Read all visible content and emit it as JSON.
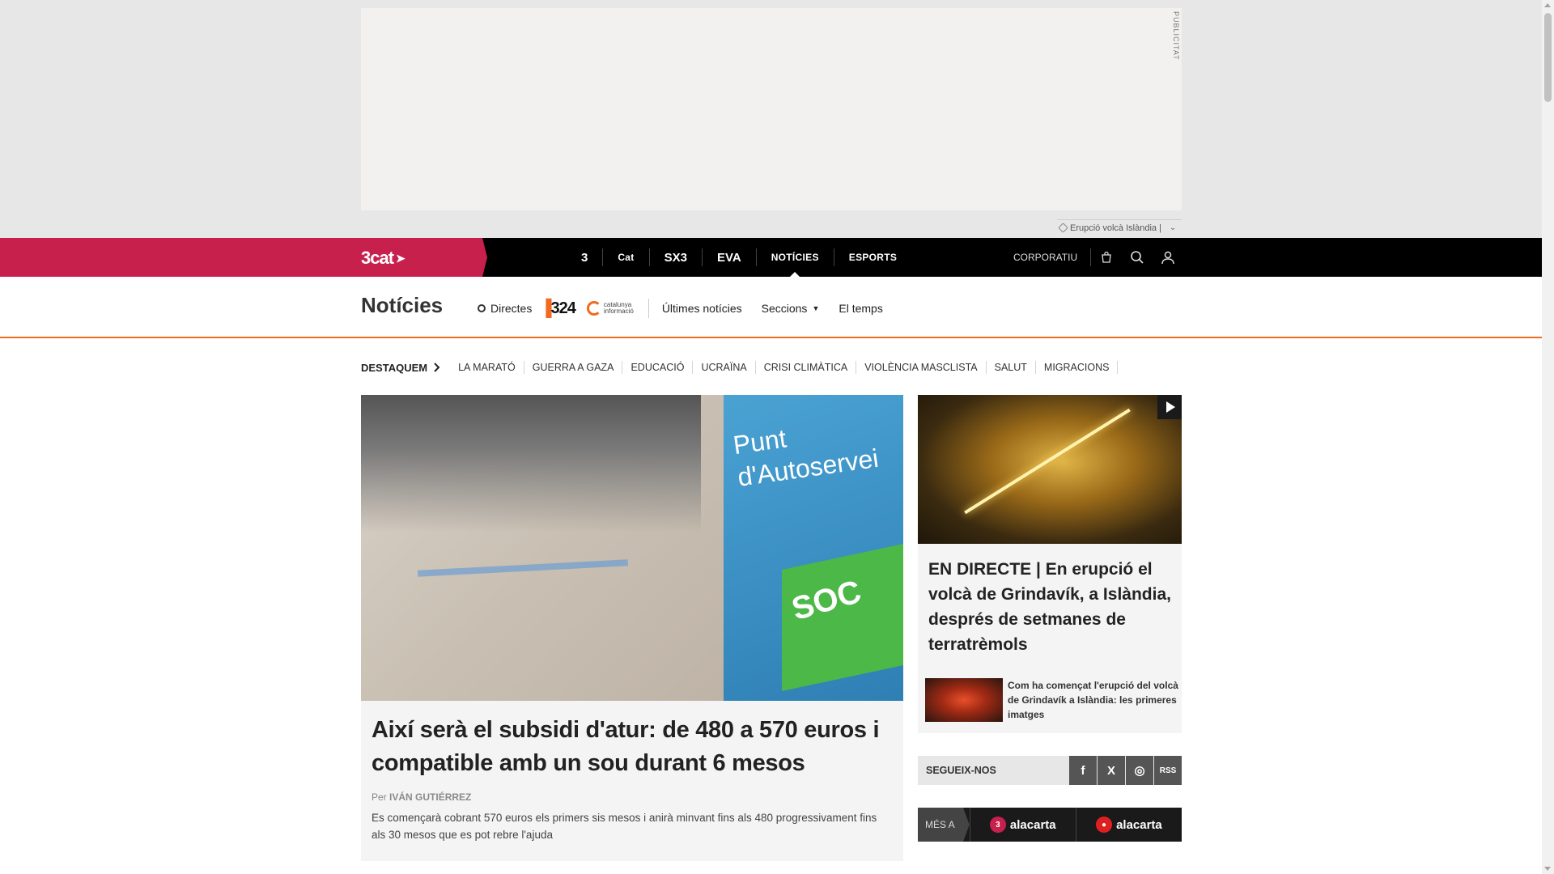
{
  "ad": {
    "label": "PUBLICITAT",
    "topic": "Erupció volcà Islàndia |"
  },
  "topnav": {
    "brand": "3cat",
    "channels": [
      {
        "label": "3",
        "name": "channel-tv3"
      },
      {
        "label": "Cat",
        "name": "channel-catradio"
      },
      {
        "label": "SX3",
        "name": "channel-sx3"
      },
      {
        "label": "EVA",
        "name": "channel-eva"
      },
      {
        "label": "NOTÍCIES",
        "name": "channel-noticies"
      },
      {
        "label": "ESPORTS",
        "name": "channel-esports"
      }
    ],
    "corporatiu": "CORPORATIU"
  },
  "section": {
    "title": "Notícies",
    "directes": "Directes",
    "logo_324": "324",
    "logo_ci_line1": "catalunya",
    "logo_ci_line2": "informació",
    "links": [
      "Últimes notícies",
      "Seccions",
      "El temps"
    ]
  },
  "tags": {
    "lead": "DESTAQUEM",
    "items": [
      "LA MARATÓ",
      "GUERRA A GAZA",
      "EDUCACIÓ",
      "UCRAÏNA",
      "CRISI CLIMÀTICA",
      "VIOLÈNCIA MASCLISTA",
      "SALUT",
      "MIGRACIONS"
    ]
  },
  "main_article": {
    "image_text_1": "Punt",
    "image_text_2": "d'Autoservei",
    "image_text_3": "SOC",
    "headline": "Així serà el subsidi d'atur: de 480 a 570 euros i compatible amb un sou durant 6 mesos",
    "byline_prefix": "Per",
    "author": "IVÁN GUTIÉRREZ",
    "summary": "Es començarà cobrant 570 euros els primers sis mesos i anirà minvant fins als 480 progressivament fins als 30 mesos que es pot rebre l'ajuda"
  },
  "side_article": {
    "headline": "EN DIRECTE | En erupció el volcà de Grindavík, a Islàndia, després de setmanes de terratrèmols",
    "related": "Com ha començat l'erupció del volcà de Grindavík a Islàndia: les primeres imatges"
  },
  "follow": {
    "label": "SEGUEIX-NOS",
    "networks": [
      "f",
      "X",
      "◎",
      "RSS"
    ]
  },
  "alacarta": {
    "mes_a": "MÉS A",
    "items": [
      "alacarta",
      "alacarta"
    ],
    "badges": [
      "3",
      "●"
    ]
  },
  "colors": {
    "brand": "#c8204d",
    "accent_orange": "#f06a1f",
    "nav_bg": "#000000"
  }
}
